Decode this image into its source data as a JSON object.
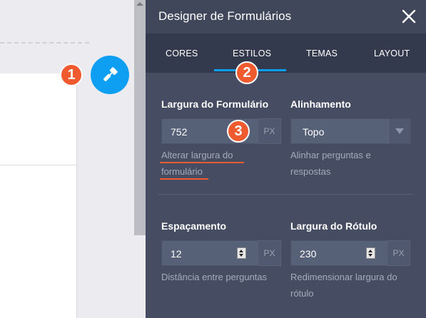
{
  "panel": {
    "title": "Designer de Formulários",
    "close_label": "close"
  },
  "tabs": [
    {
      "label": "CORES"
    },
    {
      "label": "ESTILOS"
    },
    {
      "label": "TEMAS"
    },
    {
      "label": "LAYOUT"
    }
  ],
  "active_tab": "ESTILOS",
  "callouts": [
    "1",
    "2",
    "3"
  ],
  "fields": {
    "form_width": {
      "label": "Largura do Formulário",
      "value": "752",
      "unit": "PX",
      "helper_line1": "Alterar largura do",
      "helper_line2": "formulário"
    },
    "alignment": {
      "label": "Alinhamento",
      "value": "Topo",
      "helper_line1": "Alinhar perguntas e",
      "helper_line2": "respostas"
    },
    "spacing": {
      "label": "Espaçamento",
      "value": "12",
      "unit": "PX",
      "helper_line1": "Distância entre perguntas"
    },
    "label_width": {
      "label": "Largura do Rótulo",
      "value": "230",
      "unit": "PX",
      "helper_line1": "Redimensionar largura do",
      "helper_line2": "rótulo"
    }
  },
  "icons": {
    "fab": "paint-roller-icon",
    "close": "close-icon",
    "select": "triangle-down-icon"
  },
  "colors": {
    "accent": "#0f9ff2",
    "callout": "#ef5b2f",
    "panel_bg": "#464d62",
    "tab_bar_bg": "#343a4d"
  }
}
